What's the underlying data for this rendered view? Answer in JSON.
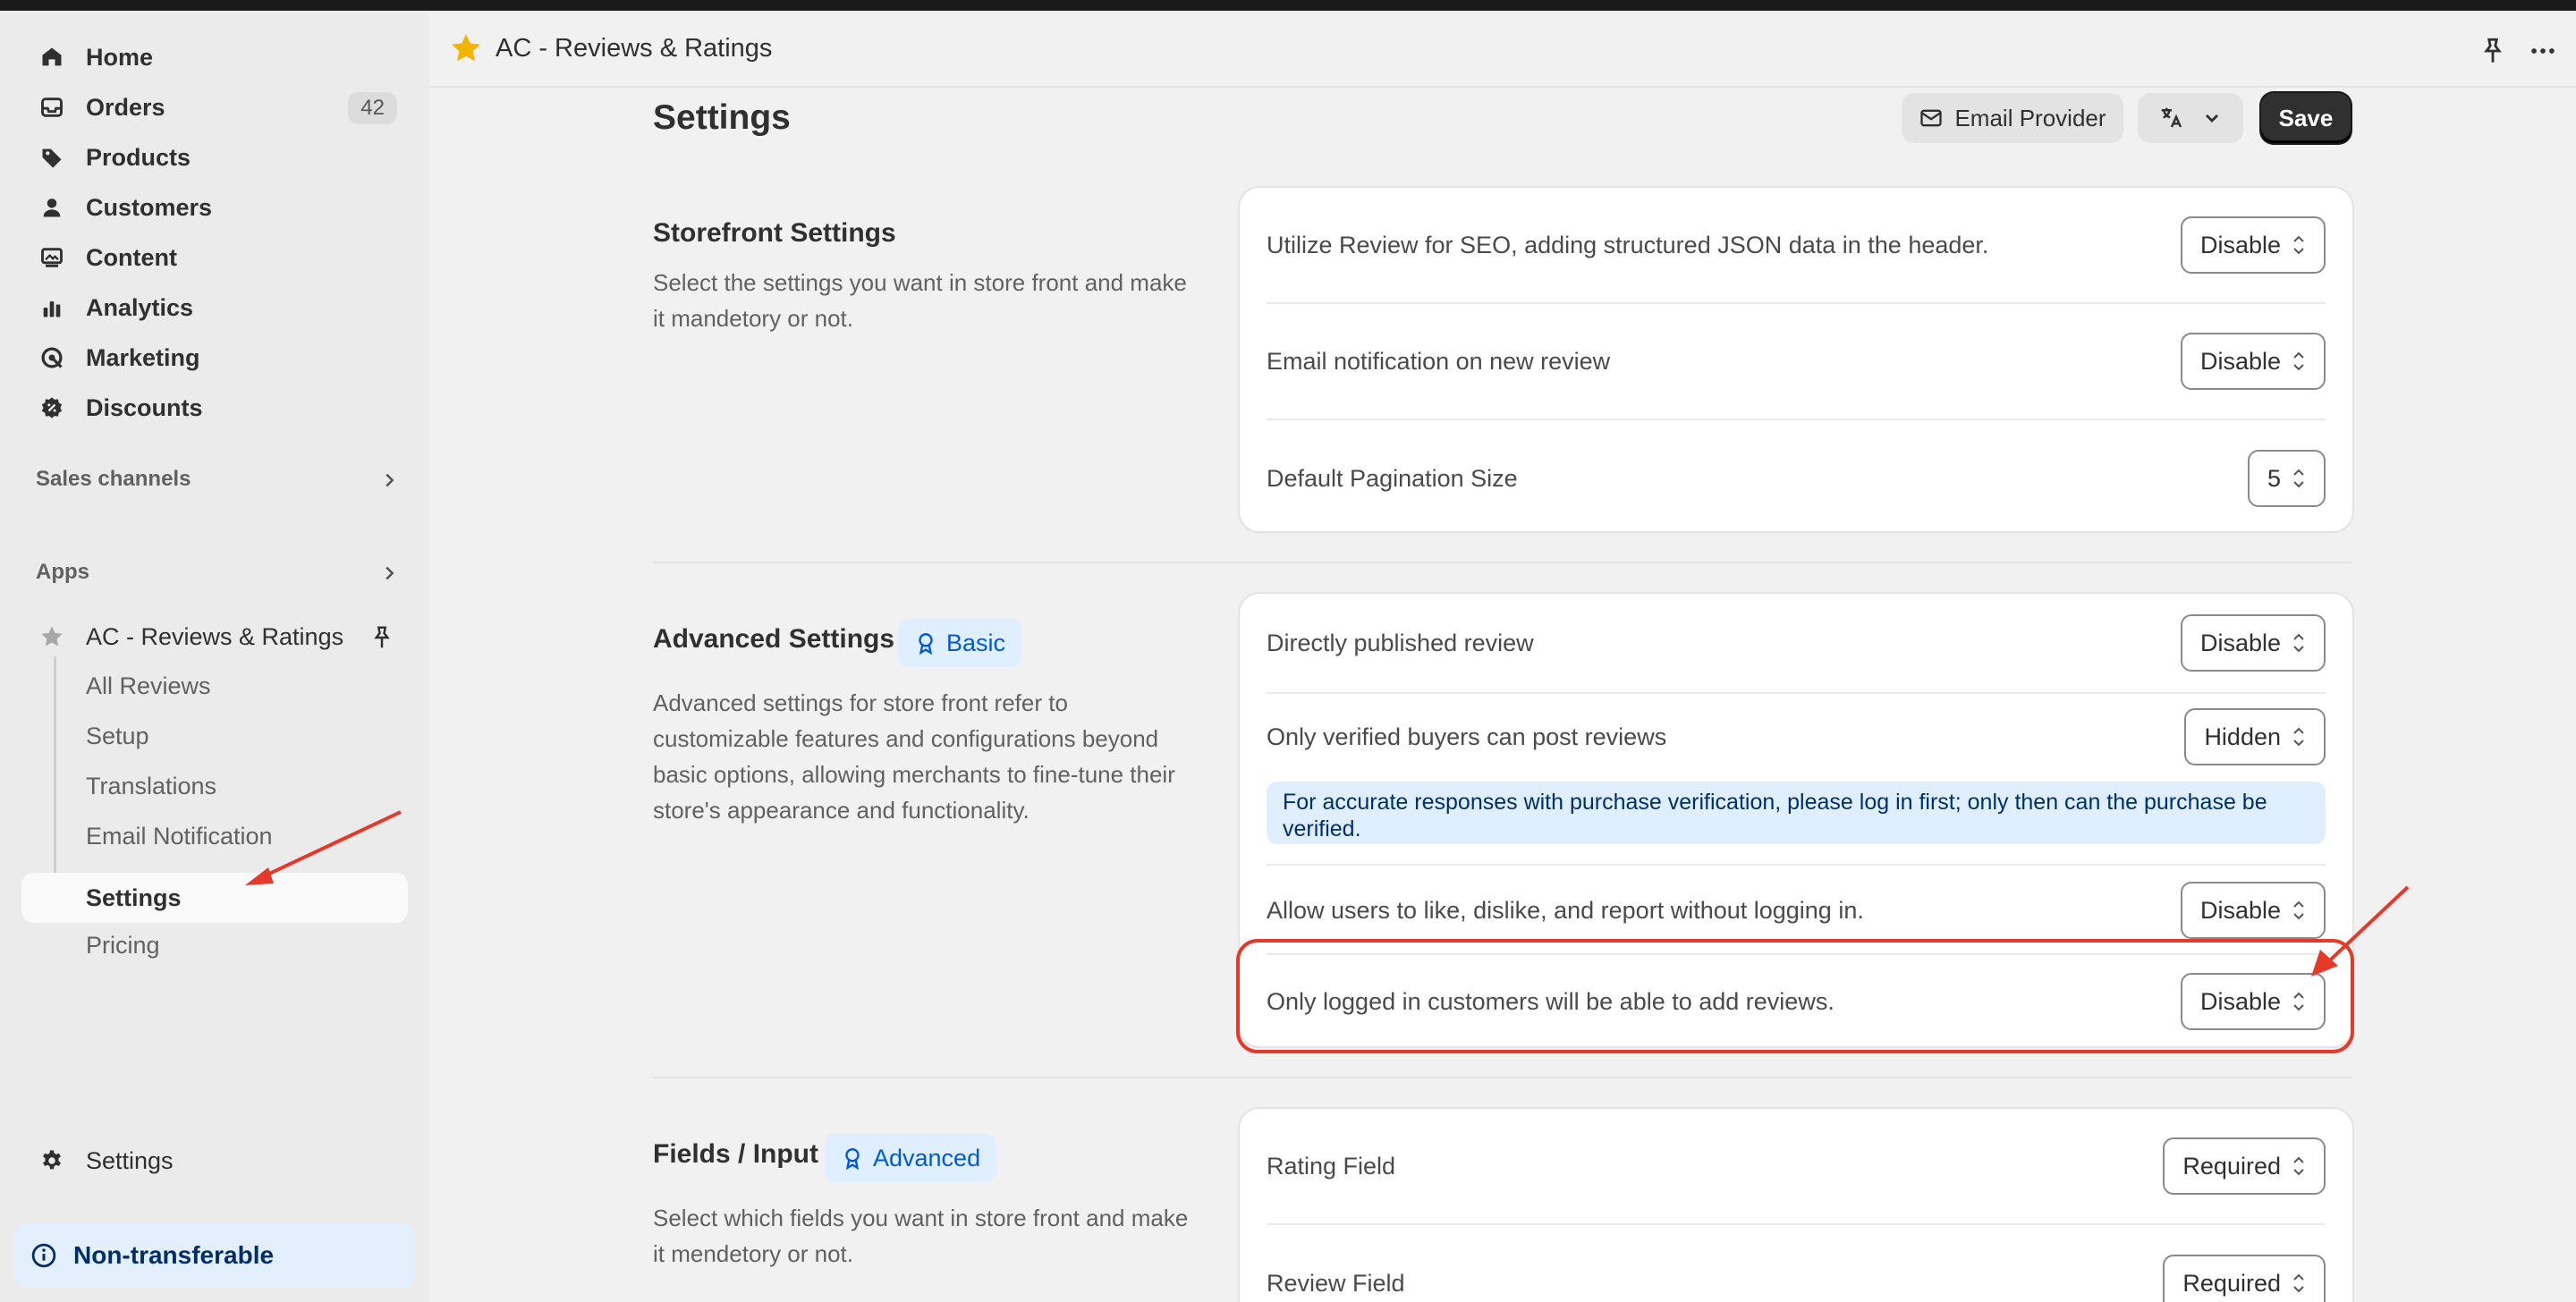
{
  "sidebar": {
    "nav": [
      {
        "label": "Home",
        "icon": "home-icon"
      },
      {
        "label": "Orders",
        "icon": "inbox-icon",
        "badge": "42"
      },
      {
        "label": "Products",
        "icon": "tag-icon"
      },
      {
        "label": "Customers",
        "icon": "person-icon"
      },
      {
        "label": "Content",
        "icon": "image-icon"
      },
      {
        "label": "Analytics",
        "icon": "bar-chart-icon"
      },
      {
        "label": "Marketing",
        "icon": "target-icon"
      },
      {
        "label": "Discounts",
        "icon": "discount-icon"
      }
    ],
    "sales_channels": "Sales channels",
    "apps": "Apps",
    "app_name": "AC - Reviews & Ratings",
    "app_sub": [
      "All Reviews",
      "Setup",
      "Translations",
      "Email Notification",
      "Settings",
      "Pricing"
    ],
    "settings": "Settings",
    "non_transferable": "Non-transferable"
  },
  "header": {
    "title": "AC - Reviews & Ratings"
  },
  "page": {
    "title": "Settings",
    "email_provider": "Email Provider",
    "save": "Save"
  },
  "storefront": {
    "title": "Storefront Settings",
    "desc": "Select the settings you want in store front and make it mandetory or not.",
    "rows": [
      {
        "label": "Utilize Review for SEO, adding structured JSON data in the header.",
        "value": "Disable"
      },
      {
        "label": "Email notification on new review",
        "value": "Disable"
      },
      {
        "label": "Default Pagination Size",
        "value": "5"
      }
    ]
  },
  "advanced": {
    "title": "Advanced Settings",
    "badge": "Basic",
    "desc": "Advanced settings for store front refer to customizable features and configurations beyond basic options, allowing merchants to fine-tune their store's appearance and functionality.",
    "rows": [
      {
        "label": "Directly published review",
        "value": "Disable"
      },
      {
        "label": "Only verified buyers can post reviews",
        "value": "Hidden"
      },
      {
        "label": "Allow users to like, dislike, and report without logging in.",
        "value": "Disable"
      },
      {
        "label": "Only logged in customers will be able to add reviews.",
        "value": "Disable"
      }
    ],
    "banner": "For accurate responses with purchase verification, please log in first; only then can the purchase be verified."
  },
  "fields": {
    "title": "Fields / Input",
    "badge": "Advanced",
    "desc": "Select which fields you want in store front and make it mendetory or not.",
    "rows": [
      {
        "label": "Rating Field",
        "value": "Required"
      },
      {
        "label": "Review Field",
        "value": "Required"
      }
    ]
  },
  "colors": {
    "accent_red": "#e5392c",
    "badge_blue": "#005bd3",
    "primary_dark": "#303030"
  }
}
